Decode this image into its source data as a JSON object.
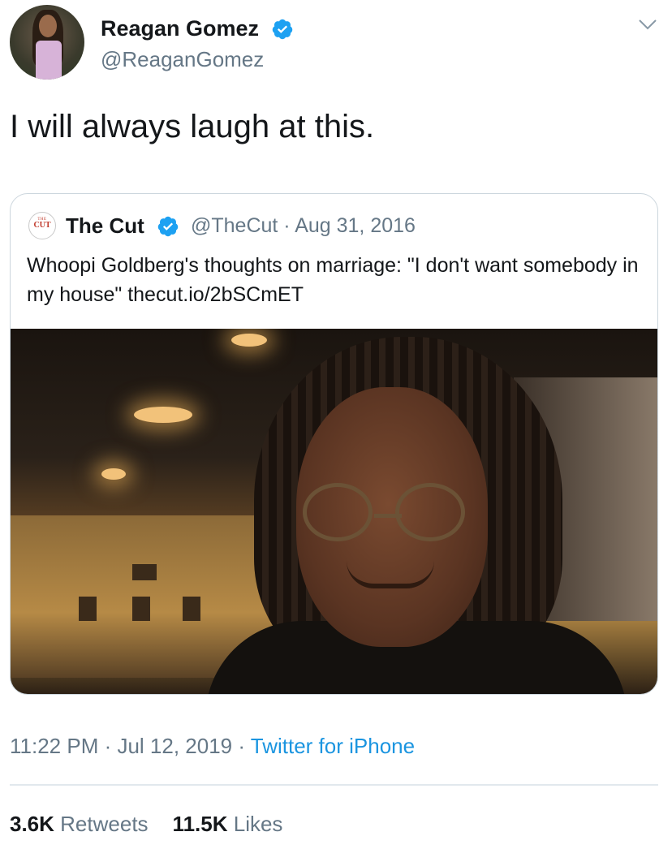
{
  "author": {
    "name": "Reagan Gomez",
    "handle": "@ReaganGomez",
    "verified_icon": "verified-badge-icon"
  },
  "tweet": {
    "text": "I will always laugh at this."
  },
  "quoted_tweet": {
    "logo_small": "THE",
    "logo_big": "CUT",
    "name": "The Cut",
    "meta": "@TheCut · Aug 31, 2016",
    "text": "Whoopi Goldberg's thoughts on marriage: \"I don't want somebody in my house\" thecut.io/2bSCmET"
  },
  "footer": {
    "time_date": "11:22 PM · Jul 12, 2019 · ",
    "source": "Twitter for iPhone",
    "retweets_count": "3.6K",
    "retweets_label": "Retweets",
    "likes_count": "11.5K",
    "likes_label": "Likes"
  },
  "colors": {
    "text": "#14171a",
    "secondary": "#657786",
    "link": "#1b95e0",
    "verified": "#1da1f2",
    "border": "#ccd6dd"
  }
}
